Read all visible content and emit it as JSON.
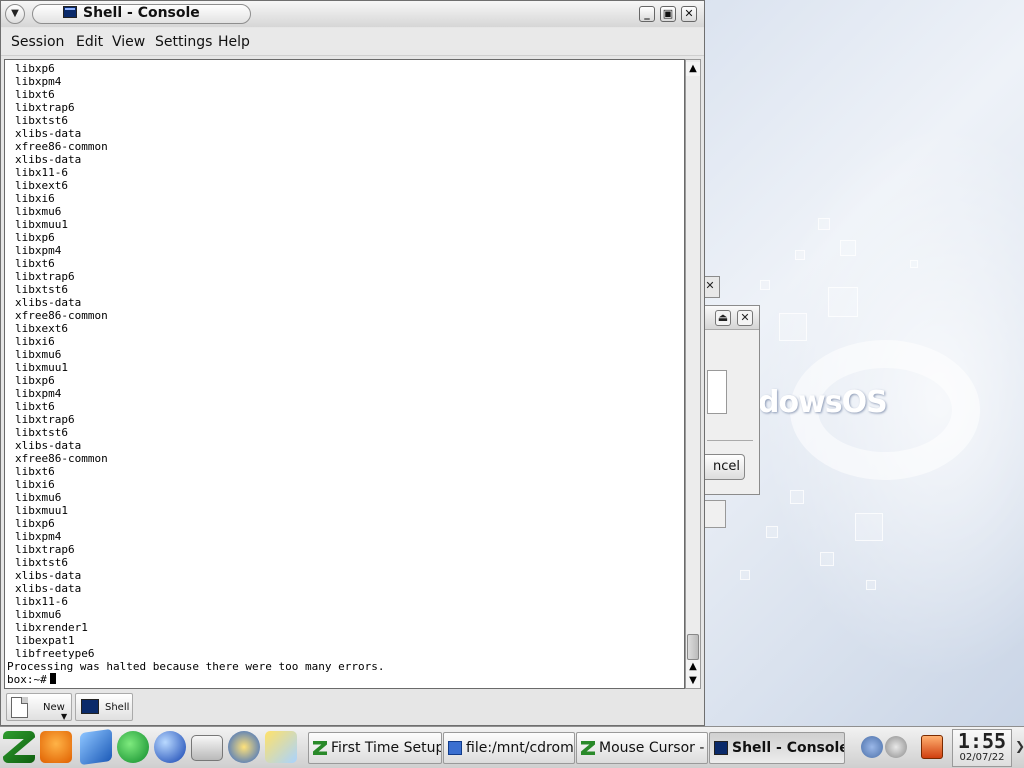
{
  "window": {
    "title": "Shell - Console",
    "menu": [
      "Session",
      "Edit",
      "View",
      "Settings",
      "Help"
    ]
  },
  "terminal": {
    "lines": [
      "libxp6",
      "libxpm4",
      "libxt6",
      "libxtrap6",
      "libxtst6",
      "xlibs-data",
      "xfree86-common",
      "xlibs-data",
      "libx11-6",
      "libxext6",
      "libxi6",
      "libxmu6",
      "libxmuu1",
      "libxp6",
      "libxpm4",
      "libxt6",
      "libxtrap6",
      "libxtst6",
      "xlibs-data",
      "xfree86-common",
      "libxext6",
      "libxi6",
      "libxmu6",
      "libxmuu1",
      "libxp6",
      "libxpm4",
      "libxt6",
      "libxtrap6",
      "libxtst6",
      "xlibs-data",
      "xfree86-common",
      "libxt6",
      "libxi6",
      "libxmu6",
      "libxmuu1",
      "libxp6",
      "libxpm4",
      "libxtrap6",
      "libxtst6",
      "xlibs-data",
      "xlibs-data",
      "libx11-6",
      "libxmu6",
      "libxrender1",
      "libexpat1",
      "libfreetype6"
    ],
    "error_message": "Processing was halted because there were too many errors.",
    "prompt": "box:~#"
  },
  "session_tabs": {
    "new_label": "New",
    "shell_label": "Shell"
  },
  "background_dialog": {
    "cancel_label": "ncel"
  },
  "desktop": {
    "brand_text": "dowsOS"
  },
  "taskbar": {
    "tasks": [
      {
        "label": "First Time Setup",
        "icon": "setup-icon"
      },
      {
        "label": "file:/mnt/cdrom1",
        "icon": "folder-icon"
      },
      {
        "label": "Mouse Cursor -",
        "icon": "setup-icon"
      },
      {
        "label": "Shell - Console",
        "icon": "terminal-icon"
      }
    ],
    "clock_time": "1:55",
    "clock_date": "02/07/22"
  },
  "colors": {
    "terminal_bg": "#ffffff",
    "terminal_fg": "#000000",
    "chrome": "#e6e6e6"
  }
}
